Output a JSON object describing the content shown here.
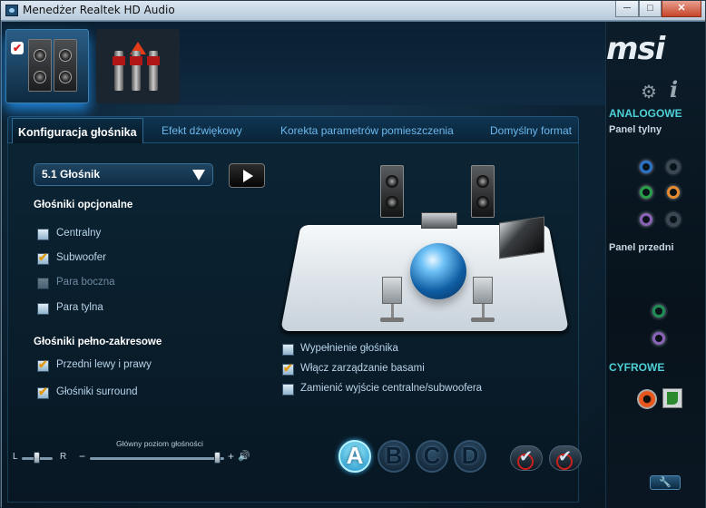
{
  "window": {
    "title": "Menedżer Realtek HD Audio",
    "min_glyph": "─",
    "max_glyph": "□",
    "close_glyph": "✕"
  },
  "device_tiles": {
    "check_glyph": "✔"
  },
  "tabs": [
    {
      "label": "Konfiguracja głośnika",
      "active": true
    },
    {
      "label": "Efekt dźwiękowy",
      "active": false
    },
    {
      "label": "Korekta parametrów pomieszczenia",
      "active": false
    },
    {
      "label": "Domyślny format",
      "active": false
    }
  ],
  "speaker_config": {
    "selected": "5.1 Głośnik"
  },
  "optional_speakers": {
    "title": "Głośniki opcjonalne",
    "items": [
      {
        "label": "Centralny",
        "checked": false,
        "enabled": true
      },
      {
        "label": "Subwoofer",
        "checked": true,
        "enabled": true
      },
      {
        "label": "Para boczna",
        "checked": false,
        "enabled": false
      },
      {
        "label": "Para tylna",
        "checked": false,
        "enabled": true
      }
    ]
  },
  "fullrange_speakers": {
    "title": "Głośniki pełno-zakresowe",
    "items": [
      {
        "label": "Przedni lewy i prawy",
        "checked": true
      },
      {
        "label": "Głośniki surround",
        "checked": true
      }
    ]
  },
  "options": [
    {
      "label": "Wypełnienie głośnika",
      "checked": false
    },
    {
      "label": "Włącz zarządzanie basami",
      "checked": true
    },
    {
      "label": "Zamienić wyjście centralne/subwoofera",
      "checked": false
    }
  ],
  "volume": {
    "label": "Główny poziom głośności",
    "balance_left": "L",
    "balance_right": "R",
    "minus": "−",
    "plus": "+",
    "speaker_glyph": "🔊",
    "level": 0.95,
    "balance": 0.5
  },
  "profiles": [
    {
      "letter": "A",
      "active": true
    },
    {
      "letter": "B",
      "active": false
    },
    {
      "letter": "C",
      "active": false
    },
    {
      "letter": "D",
      "active": false
    }
  ],
  "sidebar": {
    "logo": "msi",
    "settings_glyph": "⚙",
    "info_glyph": "i",
    "analog_title": "ANALOGOWE",
    "rear_panel": "Panel tylny",
    "front_panel": "Panel przedni",
    "digital_title": "CYFROWE",
    "wrench_glyph": "🔧",
    "jack_colors": {
      "blue": "#2a72c9",
      "green": "#27a048",
      "orange": "#e88a2e",
      "purple": "#8a63b8",
      "grey": "#3a4652",
      "front_green": "#1f8d54",
      "front_purple": "#8a63b8"
    }
  }
}
